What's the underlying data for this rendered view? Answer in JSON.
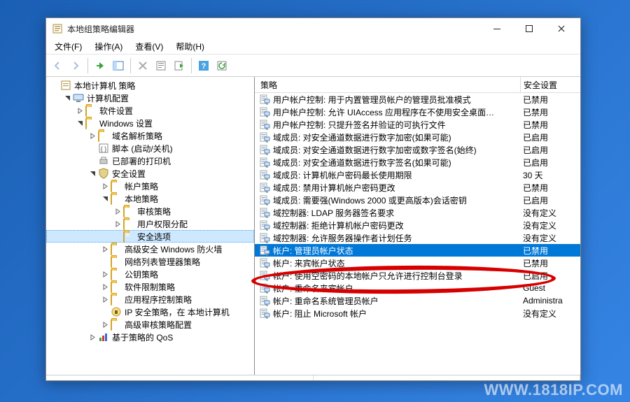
{
  "window": {
    "title": "本地组策略编辑器"
  },
  "menu": {
    "file": "文件(F)",
    "action": "操作(A)",
    "view": "查看(V)",
    "help": "帮助(H)"
  },
  "tree": {
    "root": "本地计算机 策略",
    "computer": "计算机配置",
    "software": "软件设置",
    "windows": "Windows 设置",
    "dns": "域名解析策略",
    "scripts": "脚本 (启动/关机)",
    "printers": "已部署的打印机",
    "security": "安全设置",
    "accountpol": "帐户策略",
    "localpol": "本地策略",
    "audit": "审核策略",
    "userrights": "用户权限分配",
    "secopts": "安全选项",
    "firewall": "高级安全 Windows 防火墙",
    "netlist": "网络列表管理器策略",
    "pubkey": "公钥策略",
    "softrestrict": "软件限制策略",
    "appcontrol": "应用程序控制策略",
    "ipsec": "IP 安全策略，在 本地计算机",
    "advaudit": "高级审核策略配置",
    "qos": "基于策略的 QoS"
  },
  "list_header": {
    "name": "策略",
    "value": "安全设置"
  },
  "policies": [
    {
      "name": "用户帐户控制: 用于内置管理员帐户的管理员批准模式",
      "value": "已禁用"
    },
    {
      "name": "用户帐户控制: 允许 UIAccess 应用程序在不使用安全桌面…",
      "value": "已禁用"
    },
    {
      "name": "用户帐户控制: 只提升签名并验证的可执行文件",
      "value": "已禁用"
    },
    {
      "name": "域成员: 对安全通道数据进行数字加密(如果可能)",
      "value": "已启用"
    },
    {
      "name": "域成员: 对安全通道数据进行数字加密或数字签名(始终)",
      "value": "已启用"
    },
    {
      "name": "域成员: 对安全通道数据进行数字签名(如果可能)",
      "value": "已启用"
    },
    {
      "name": "域成员: 计算机帐户密码最长使用期限",
      "value": "30 天"
    },
    {
      "name": "域成员: 禁用计算机帐户密码更改",
      "value": "已禁用"
    },
    {
      "name": "域成员: 需要强(Windows 2000 或更高版本)会话密钥",
      "value": "已启用"
    },
    {
      "name": "域控制器: LDAP 服务器签名要求",
      "value": "没有定义"
    },
    {
      "name": "域控制器: 拒绝计算机帐户密码更改",
      "value": "没有定义"
    },
    {
      "name": "域控制器: 允许服务器操作者计划任务",
      "value": "没有定义"
    },
    {
      "name": "帐户: 管理员帐户状态",
      "value": "已禁用"
    },
    {
      "name": "帐户: 来宾帐户状态",
      "value": "已禁用"
    },
    {
      "name": "帐户: 使用空密码的本地帐户只允许进行控制台登录",
      "value": "已启用"
    },
    {
      "name": "帐户: 重命名来宾帐户",
      "value": "Guest"
    },
    {
      "name": "帐户: 重命名系统管理员帐户",
      "value": "Administra"
    },
    {
      "name": "帐户: 阻止 Microsoft 帐户",
      "value": "没有定义"
    }
  ],
  "selected_policy_index": 12,
  "watermark": "WWW.1818IP.COM"
}
